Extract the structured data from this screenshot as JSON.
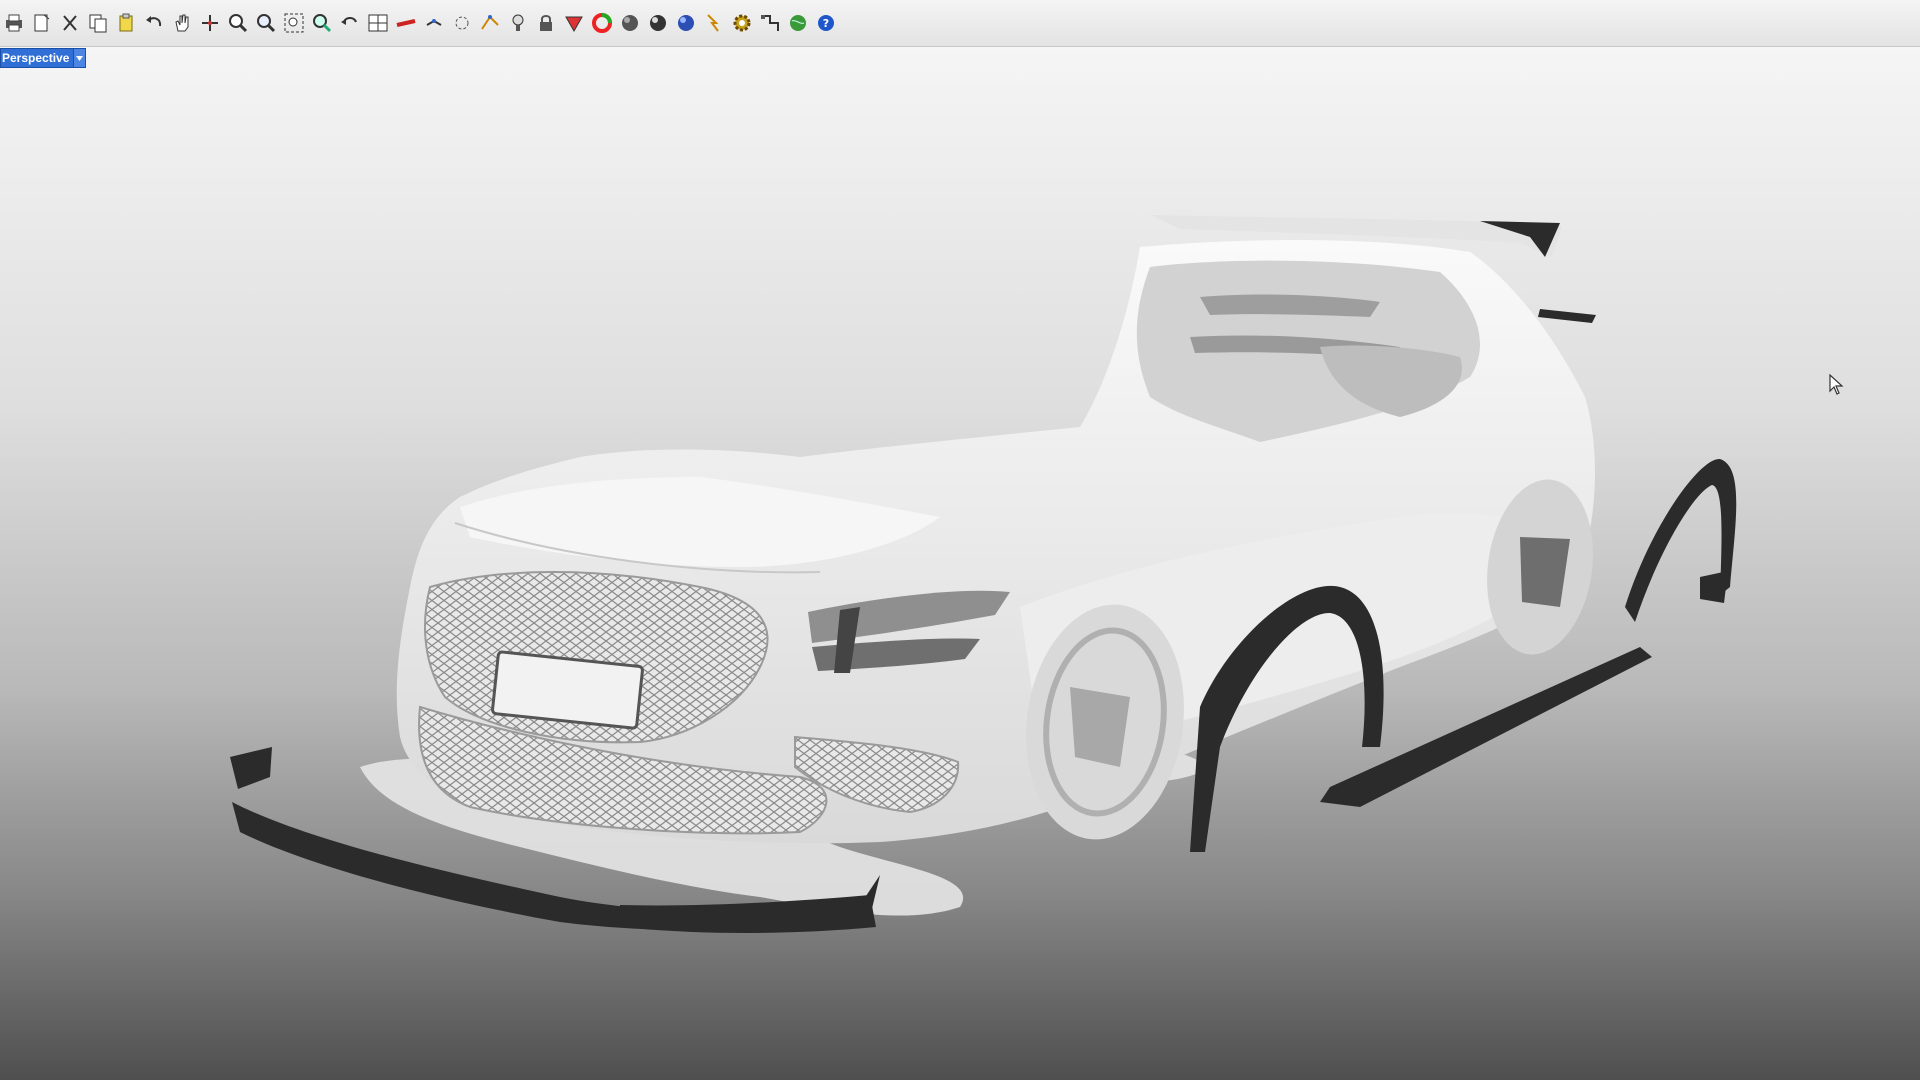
{
  "app": {
    "toolbar": {
      "buttons": [
        {
          "icon": "print-icon"
        },
        {
          "icon": "page-setup-icon"
        },
        {
          "icon": "cut-icon"
        },
        {
          "icon": "copy-icon"
        },
        {
          "icon": "paste-icon"
        },
        {
          "icon": "undo-icon"
        },
        {
          "icon": "pan-hand-icon"
        },
        {
          "icon": "rotate-view-icon"
        },
        {
          "icon": "zoom-dynamic-icon"
        },
        {
          "icon": "zoom-window-icon"
        },
        {
          "icon": "zoom-extents-icon"
        },
        {
          "icon": "zoom-selected-icon"
        },
        {
          "icon": "undo-view-icon"
        },
        {
          "icon": "four-viewports-icon"
        },
        {
          "icon": "construction-plane-icon"
        },
        {
          "icon": "osnap-icon"
        },
        {
          "icon": "select-window-icon"
        },
        {
          "icon": "point-edit-icon"
        },
        {
          "icon": "light-icon"
        },
        {
          "icon": "lock-icon"
        },
        {
          "icon": "layer-color-icon"
        },
        {
          "icon": "color-wheel-icon"
        },
        {
          "icon": "shaded-sphere-icon"
        },
        {
          "icon": "render-sphere-icon"
        },
        {
          "icon": "material-sphere-icon"
        },
        {
          "icon": "analysis-icon"
        },
        {
          "icon": "settings-gear-icon"
        },
        {
          "icon": "layout-icon"
        },
        {
          "icon": "environment-globe-icon"
        },
        {
          "icon": "help-icon"
        }
      ]
    },
    "viewport": {
      "label": "Perspective",
      "dropdown_icon": "chevron-down-icon"
    },
    "colors": {
      "viewport_label_bg": "#2f6fd6",
      "model_surface": "#f3f3f3",
      "aero_parts": "#2b2b2b"
    }
  }
}
